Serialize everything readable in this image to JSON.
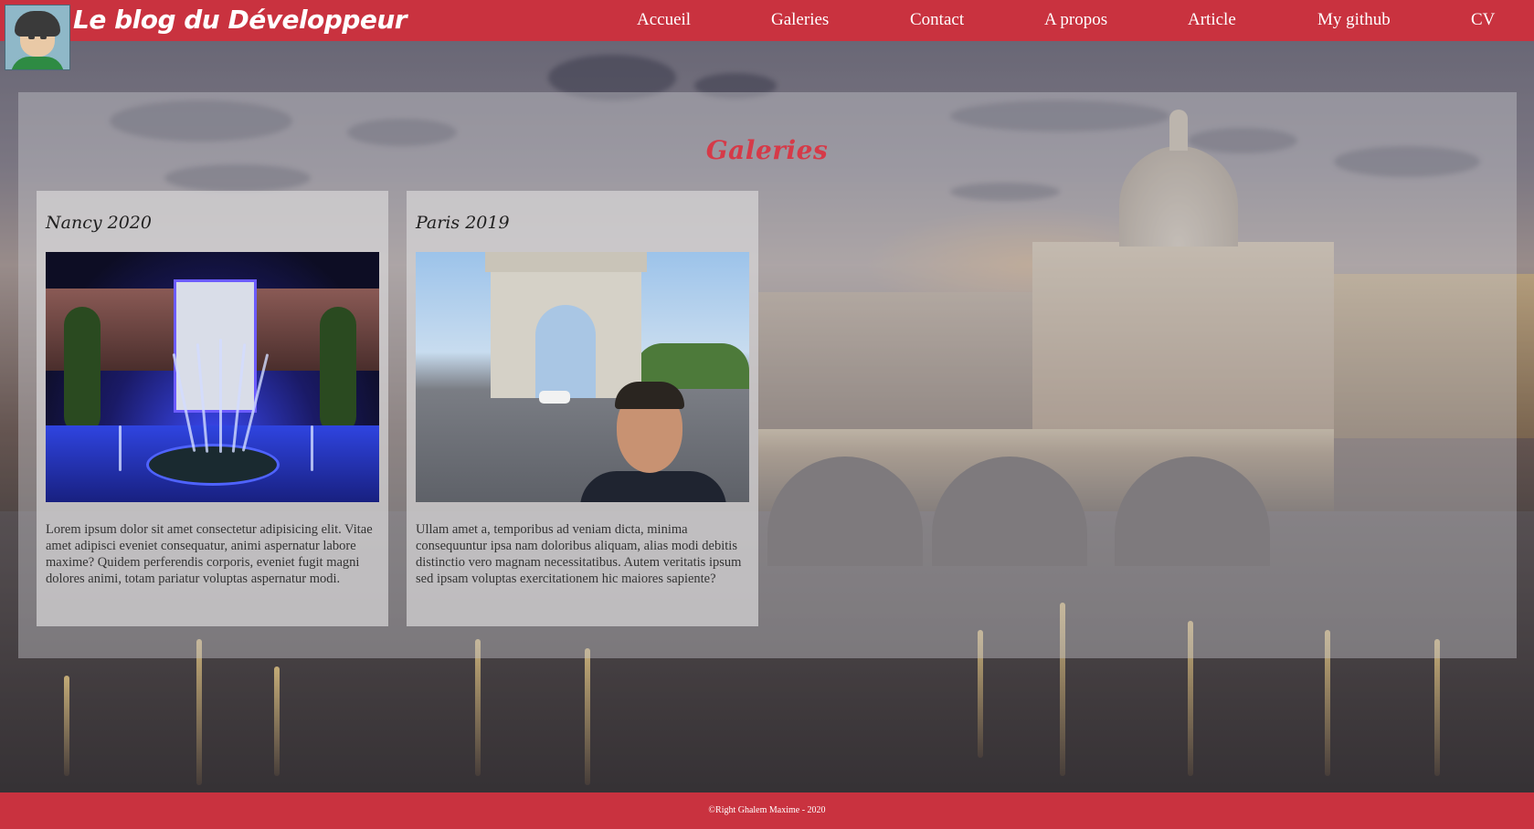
{
  "header": {
    "site_title": "Le blog du Développeur",
    "nav": [
      "Accueil",
      "Galeries",
      "Contact",
      "A propos",
      "Article",
      "My github",
      "CV"
    ]
  },
  "main": {
    "section_title": "Galeries",
    "cards": [
      {
        "title": "Nancy 2020",
        "text": "Lorem ipsum dolor sit amet consectetur adipisicing elit. Vitae amet adipisci eveniet consequatur, animi aspernatur labore maxime? Quidem perferendis corporis, eveniet fugit magni dolores animi, totam pariatur voluptas aspernatur modi."
      },
      {
        "title": "Paris 2019",
        "text": "Ullam amet a, temporibus ad veniam dicta, minima consequuntur ipsa nam doloribus aliquam, alias modi debitis distinctio vero magnam necessitatibus. Autem veritatis ipsum sed ipsam voluptas exercitationem hic maiores sapiente?"
      }
    ]
  },
  "footer": {
    "copyright": "©Right Ghalem Maxime - 2020"
  },
  "colors": {
    "accent": "#c9323f",
    "title_red": "#d63a48"
  }
}
